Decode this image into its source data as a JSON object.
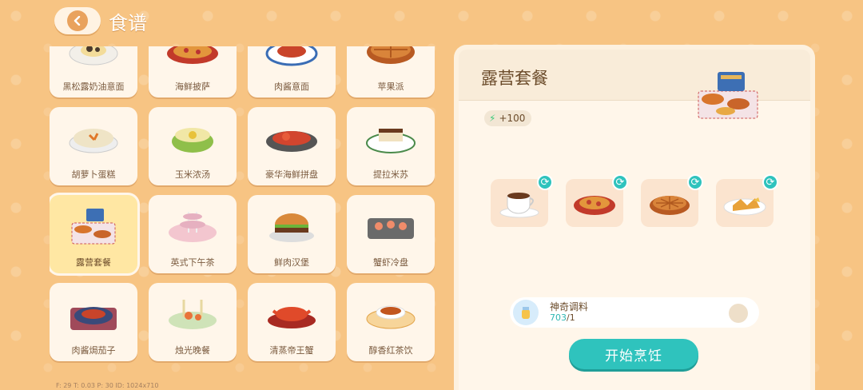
{
  "header": {
    "title": "食谱"
  },
  "recipes": [
    {
      "label": "黑松露奶油意面",
      "icon": "truffle-pasta-icon"
    },
    {
      "label": "海鲜披萨",
      "icon": "seafood-pizza-icon"
    },
    {
      "label": "肉酱意面",
      "icon": "bolognese-icon"
    },
    {
      "label": "苹果派",
      "icon": "apple-pie-icon"
    },
    {
      "label": "胡萝卜蛋糕",
      "icon": "carrot-cake-icon"
    },
    {
      "label": "玉米浓汤",
      "icon": "corn-soup-icon"
    },
    {
      "label": "豪华海鲜拼盘",
      "icon": "seafood-platter-icon"
    },
    {
      "label": "提拉米苏",
      "icon": "tiramisu-icon"
    },
    {
      "label": "露营套餐",
      "icon": "camping-meal-icon",
      "selected": true
    },
    {
      "label": "英式下午茶",
      "icon": "afternoon-tea-icon"
    },
    {
      "label": "鲜肉汉堡",
      "icon": "burger-icon"
    },
    {
      "label": "蟹虾冷盘",
      "icon": "crab-shrimp-platter-icon"
    },
    {
      "label": "肉酱焗茄子",
      "icon": "baked-eggplant-icon"
    },
    {
      "label": "烛光晚餐",
      "icon": "candlelight-dinner-icon"
    },
    {
      "label": "清蒸帝王蟹",
      "icon": "king-crab-icon"
    },
    {
      "label": "醇香红茶饮",
      "icon": "black-tea-icon"
    }
  ],
  "detail": {
    "title": "露营套餐",
    "energy": "+100",
    "ingredients": [
      {
        "name": "coffee-cup-icon"
      },
      {
        "name": "seafood-pizza-icon"
      },
      {
        "name": "apple-pie-icon"
      },
      {
        "name": "fried-fish-icon"
      }
    ],
    "magic": {
      "name": "神奇调料",
      "count": "703",
      "required": "/1"
    },
    "cook_button": "开始烹饪"
  },
  "debug": "F: 29   T: 0.03   P: 30   ID: 1024x710",
  "colors": {
    "background": "#f7c483",
    "accent": "#2fc3bd",
    "text": "#6b4b2a"
  }
}
